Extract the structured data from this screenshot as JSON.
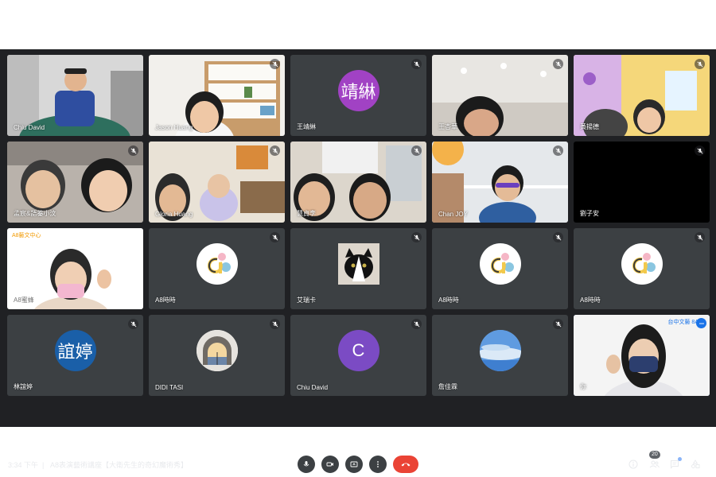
{
  "meeting": {
    "time": "3:34 下午",
    "separator": "|",
    "title": "A8表演藝術講座【大衛先生的奇幻魔術秀】",
    "participant_count": "20"
  },
  "colors": {
    "background": "#202124",
    "tile": "#3c4043",
    "end_call": "#ea4335",
    "self_outline": "#8ab4f8"
  },
  "tiles": [
    {
      "name": "Chiu David",
      "type": "video"
    },
    {
      "name": "Jason Huang",
      "type": "video"
    },
    {
      "name": "王靖綝",
      "type": "avatar",
      "avatar_text": "靖綝",
      "avatar_color": "#a142c4"
    },
    {
      "name": "王杏華",
      "type": "video"
    },
    {
      "name": "黃揚德",
      "type": "video"
    },
    {
      "name": "孟宸&語蓁小汶",
      "type": "video"
    },
    {
      "name": "Gloria Huang",
      "type": "video"
    },
    {
      "name": "慧貞李",
      "type": "video"
    },
    {
      "name": "Chan JOY",
      "type": "video"
    },
    {
      "name": "劉子安",
      "type": "black"
    },
    {
      "name": "A8蜜蜂",
      "type": "video",
      "logo_text": "A8藝文中心"
    },
    {
      "name": "A8時時",
      "type": "avatar",
      "avatar_icon": "a8-logo-icon"
    },
    {
      "name": "艾瑞卡",
      "type": "avatar",
      "avatar_icon": "cat-photo-icon"
    },
    {
      "name": "A8時時",
      "type": "avatar",
      "avatar_icon": "a8-logo-icon"
    },
    {
      "name": "A8時時",
      "type": "avatar",
      "avatar_icon": "a8-logo-icon"
    },
    {
      "name": "林誼婷",
      "type": "avatar",
      "avatar_text": "誼婷",
      "avatar_color": "#1a5fa8"
    },
    {
      "name": "DIDI TASI",
      "type": "avatar",
      "avatar_icon": "arch-photo-icon"
    },
    {
      "name": "Chiu David",
      "type": "avatar",
      "avatar_text": "C",
      "avatar_color": "#7b4bc4"
    },
    {
      "name": "詹佳霖",
      "type": "avatar",
      "avatar_icon": "sky-photo-icon"
    },
    {
      "name": "你",
      "type": "video",
      "self": true,
      "logo_text": "台中文藝 8A"
    }
  ]
}
